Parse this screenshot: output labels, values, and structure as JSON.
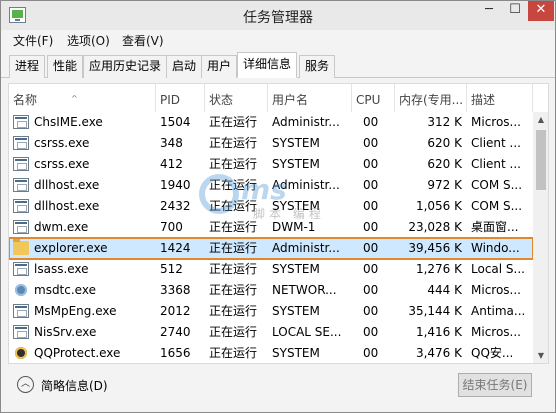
{
  "window": {
    "title": "任务管理器",
    "controls": {
      "minimize": "─",
      "maximize": "☐",
      "close": "✕"
    }
  },
  "menu": [
    "文件(F)",
    "选项(O)",
    "查看(V)"
  ],
  "tabs": [
    {
      "label": "进程",
      "active": false
    },
    {
      "label": "性能",
      "active": false
    },
    {
      "label": "应用历史记录",
      "active": false
    },
    {
      "label": "启动",
      "active": false
    },
    {
      "label": "用户",
      "active": false
    },
    {
      "label": "详细信息",
      "active": true
    },
    {
      "label": "服务",
      "active": false
    }
  ],
  "table": {
    "columns": [
      "名称",
      "PID",
      "状态",
      "用户名",
      "CPU",
      "内存(专用...",
      "描述"
    ],
    "rows": [
      {
        "icon": "window-icon",
        "name": "ChsIME.exe",
        "pid": "1504",
        "status": "正在运行",
        "user": "Administr...",
        "cpu": "00",
        "mem": "312 K",
        "desc": "Micros..."
      },
      {
        "icon": "window-icon",
        "name": "csrss.exe",
        "pid": "348",
        "status": "正在运行",
        "user": "SYSTEM",
        "cpu": "00",
        "mem": "620 K",
        "desc": "Client ..."
      },
      {
        "icon": "window-icon",
        "name": "csrss.exe",
        "pid": "412",
        "status": "正在运行",
        "user": "SYSTEM",
        "cpu": "00",
        "mem": "620 K",
        "desc": "Client ..."
      },
      {
        "icon": "window-icon",
        "name": "dllhost.exe",
        "pid": "1940",
        "status": "正在运行",
        "user": "Administr...",
        "cpu": "00",
        "mem": "972 K",
        "desc": "COM S..."
      },
      {
        "icon": "window-icon",
        "name": "dllhost.exe",
        "pid": "2432",
        "status": "正在运行",
        "user": "SYSTEM",
        "cpu": "00",
        "mem": "1,056 K",
        "desc": "COM S..."
      },
      {
        "icon": "window-icon",
        "name": "dwm.exe",
        "pid": "700",
        "status": "正在运行",
        "user": "DWM-1",
        "cpu": "00",
        "mem": "23,028 K",
        "desc": "桌面窗..."
      },
      {
        "icon": "folder-icon",
        "name": "explorer.exe",
        "pid": "1424",
        "status": "正在运行",
        "user": "Administr...",
        "cpu": "00",
        "mem": "39,456 K",
        "desc": "Windo...",
        "selected": true
      },
      {
        "icon": "window-icon",
        "name": "lsass.exe",
        "pid": "512",
        "status": "正在运行",
        "user": "SYSTEM",
        "cpu": "00",
        "mem": "1,276 K",
        "desc": "Local S..."
      },
      {
        "icon": "gear-icon",
        "name": "msdtc.exe",
        "pid": "3368",
        "status": "正在运行",
        "user": "NETWOR...",
        "cpu": "00",
        "mem": "444 K",
        "desc": "Micros..."
      },
      {
        "icon": "window-icon",
        "name": "MsMpEng.exe",
        "pid": "2012",
        "status": "正在运行",
        "user": "SYSTEM",
        "cpu": "00",
        "mem": "35,144 K",
        "desc": "Antima..."
      },
      {
        "icon": "window-icon",
        "name": "NisSrv.exe",
        "pid": "2740",
        "status": "正在运行",
        "user": "LOCAL SE...",
        "cpu": "00",
        "mem": "1,416 K",
        "desc": "Micros..."
      },
      {
        "icon": "qq-icon",
        "name": "QQProtect.exe",
        "pid": "1656",
        "status": "正在运行",
        "user": "SYSTEM",
        "cpu": "00",
        "mem": "3,476 K",
        "desc": "QQ安..."
      }
    ]
  },
  "footer": {
    "fewer_details": "简略信息(D)",
    "end_task": "结束任务(E)"
  },
  "colors": {
    "selection_outline": "#e0892c",
    "selection_fill": "#cde8ff",
    "close_button": "#c7463f"
  }
}
